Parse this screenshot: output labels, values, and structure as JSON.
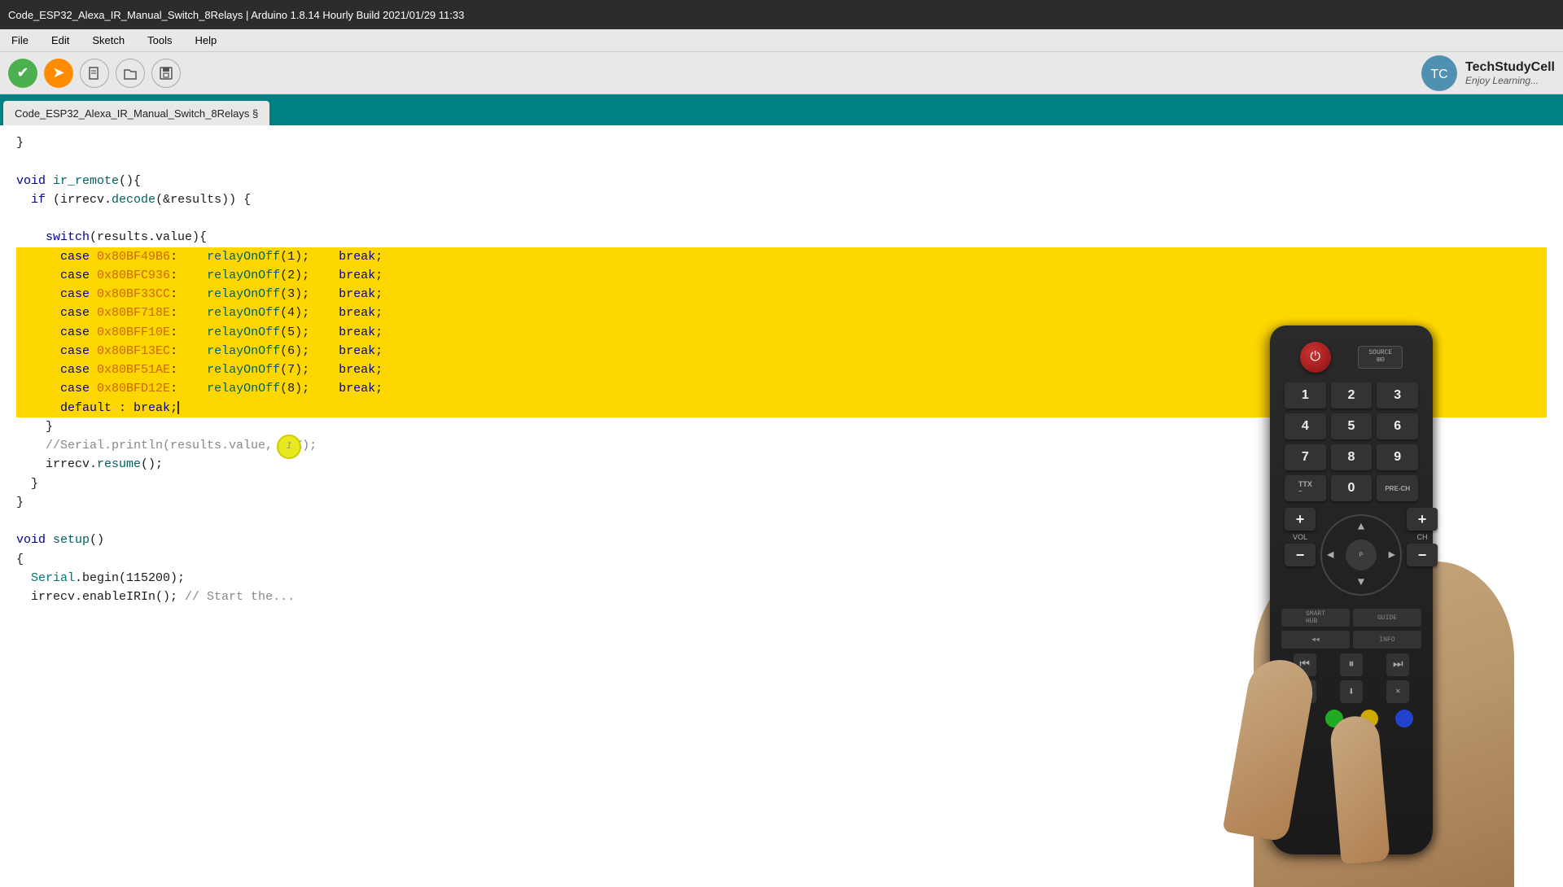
{
  "window": {
    "title": "Code_ESP32_Alexa_IR_Manual_Switch_8Relays | Arduino 1.8.14 Hourly Build 2021/01/29 11:33"
  },
  "menu": {
    "items": [
      "File",
      "Edit",
      "Sketch",
      "Tools",
      "Help"
    ]
  },
  "toolbar": {
    "verify_label": "✓",
    "upload_label": "→",
    "new_label": "📄",
    "open_label": "↑",
    "save_label": "↓"
  },
  "brand": {
    "name": "TechStudyCell",
    "subtitle": "Enjoy Learning..."
  },
  "tab": {
    "label": "Code_ESP32_Alexa_IR_Manual_Switch_8Relays §"
  },
  "code": {
    "lines": [
      {
        "text": "}",
        "highlight": false,
        "indent": 0
      },
      {
        "text": "",
        "highlight": false
      },
      {
        "text": "void ir_remote(){",
        "highlight": false
      },
      {
        "text": "  if (irrecv.decode(&results)) {",
        "highlight": false
      },
      {
        "text": "",
        "highlight": false
      },
      {
        "text": "    switch(results.value){",
        "highlight": false
      },
      {
        "text": "      case 0x80BF49B6:    relayOnOff(1);    break;",
        "highlight": true
      },
      {
        "text": "      case 0x80BFC936:    relayOnOff(2);    break;",
        "highlight": true
      },
      {
        "text": "      case 0x80BF33CC:    relayOnOff(3);    break;",
        "highlight": true
      },
      {
        "text": "      case 0x80BF718E:    relayOnOff(4);    break;",
        "highlight": true
      },
      {
        "text": "      case 0x80BFF10E:    relayOnOff(5);    break;",
        "highlight": true
      },
      {
        "text": "      case 0x80BF13EC:    relayOnOff(6);    break;",
        "highlight": true
      },
      {
        "text": "      case 0x80BF51AE:    relayOnOff(7);    break;",
        "highlight": true
      },
      {
        "text": "      case 0x80BFD12E:    relayOnOff(8);    break;",
        "highlight": true
      },
      {
        "text": "      default : break;",
        "highlight": true
      },
      {
        "text": "    }",
        "highlight": false
      },
      {
        "text": "    //Serial.println(results.value, HEX);",
        "highlight": false
      },
      {
        "text": "    irrecv.resume();",
        "highlight": false
      },
      {
        "text": "  }",
        "highlight": false
      },
      {
        "text": "}",
        "highlight": false
      },
      {
        "text": "",
        "highlight": false
      },
      {
        "text": "void setup()",
        "highlight": false
      },
      {
        "text": "{",
        "highlight": false
      },
      {
        "text": "  Serial.begin(115200);",
        "highlight": false
      },
      {
        "text": "  irrecv.enableIRIn(); // Start the...",
        "highlight": false
      }
    ]
  }
}
